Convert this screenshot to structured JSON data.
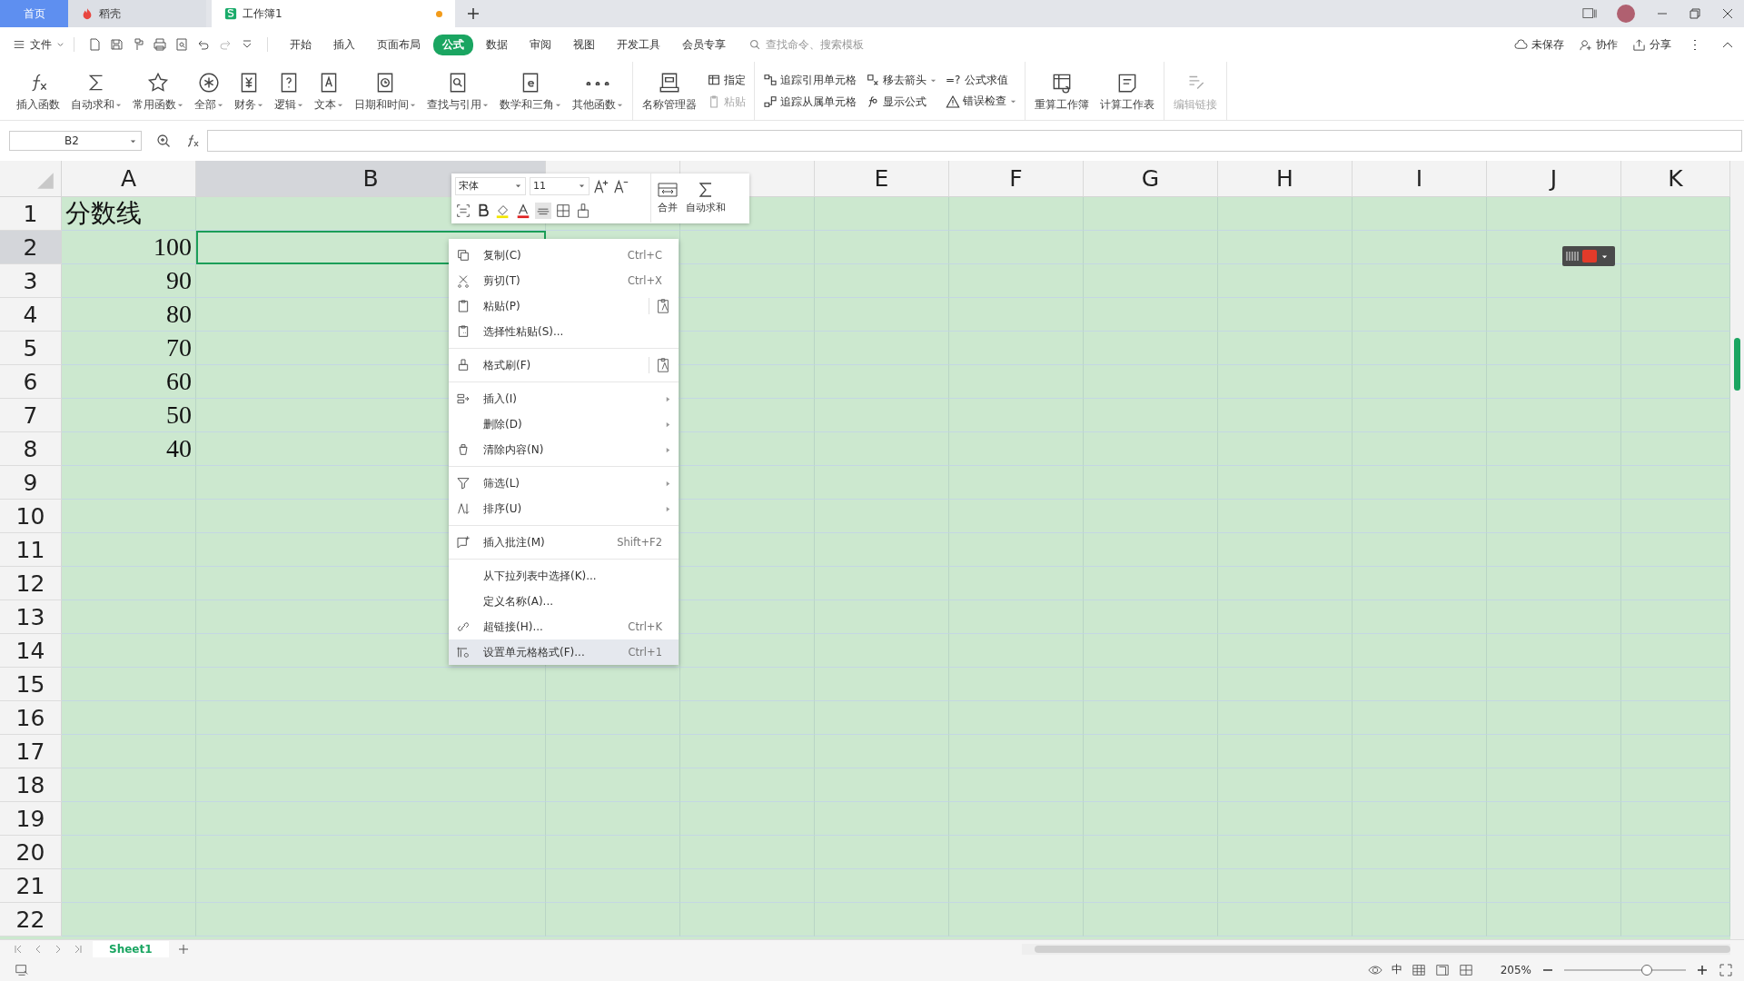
{
  "title_tabs": [
    {
      "label": "首页",
      "kind": "home",
      "selected": false,
      "unsaved": false
    },
    {
      "label": "稻壳",
      "kind": "docer",
      "selected": false,
      "unsaved": false
    },
    {
      "label": "工作簿1",
      "kind": "sheet",
      "selected": true,
      "unsaved": true
    }
  ],
  "menu": {
    "file": "文件",
    "tabs": [
      {
        "label": "开始",
        "selected": false
      },
      {
        "label": "插入",
        "selected": false
      },
      {
        "label": "页面布局",
        "selected": false
      },
      {
        "label": "公式",
        "selected": true
      },
      {
        "label": "数据",
        "selected": false
      },
      {
        "label": "审阅",
        "selected": false
      },
      {
        "label": "视图",
        "selected": false
      },
      {
        "label": "开发工具",
        "selected": false
      },
      {
        "label": "会员专享",
        "selected": false
      }
    ],
    "search": {
      "placeholder": "查找命令、搜索模板"
    },
    "actions": [
      "未保存",
      "协作",
      "分享"
    ]
  },
  "ribbon": {
    "groups": [
      {
        "columns": [
          [
            {
              "label": "插入函数",
              "kind": "large",
              "dropdown": false,
              "disabled": false
            }
          ],
          [
            {
              "label": "自动求和",
              "kind": "large",
              "dropdown": true,
              "disabled": false
            }
          ],
          [
            {
              "label": "常用函数",
              "kind": "large",
              "dropdown": true,
              "disabled": false
            }
          ],
          [
            {
              "label": "全部",
              "kind": "large",
              "dropdown": true,
              "disabled": false
            }
          ],
          [
            {
              "label": "财务",
              "kind": "large",
              "dropdown": true,
              "disabled": false
            }
          ],
          [
            {
              "label": "逻辑",
              "kind": "large",
              "dropdown": true,
              "disabled": false
            }
          ],
          [
            {
              "label": "文本",
              "kind": "large",
              "dropdown": true,
              "disabled": false
            }
          ],
          [
            {
              "label": "日期和时间",
              "kind": "large",
              "dropdown": true,
              "disabled": false
            }
          ],
          [
            {
              "label": "查找与引用",
              "kind": "large",
              "dropdown": true,
              "disabled": false
            }
          ],
          [
            {
              "label": "数学和三角",
              "kind": "large",
              "dropdown": true,
              "disabled": false
            }
          ],
          [
            {
              "label": "其他函数",
              "kind": "large",
              "dropdown": true,
              "disabled": false
            }
          ]
        ]
      },
      {
        "columns": [
          [
            {
              "label": "名称管理器",
              "kind": "large",
              "dropdown": false,
              "disabled": false
            }
          ],
          [
            {
              "label": "指定",
              "kind": "small",
              "dropdown": false,
              "disabled": false
            },
            {
              "label": "粘贴",
              "kind": "small",
              "dropdown": false,
              "disabled": true
            }
          ]
        ]
      },
      {
        "columns": [
          [
            {
              "label": "追踪引用单元格",
              "kind": "small",
              "dropdown": false,
              "disabled": false
            },
            {
              "label": "追踪从属单元格",
              "kind": "small",
              "dropdown": false,
              "disabled": false
            }
          ],
          [
            {
              "label": "移去箭头",
              "kind": "small",
              "dropdown": true,
              "disabled": false
            },
            {
              "label": "显示公式",
              "kind": "small",
              "dropdown": false,
              "disabled": false
            }
          ],
          [
            {
              "label": "公式求值",
              "kind": "small",
              "icon_text": "=?",
              "dropdown": false,
              "disabled": false
            },
            {
              "label": "错误检查",
              "kind": "small",
              "dropdown": true,
              "disabled": false
            }
          ]
        ]
      },
      {
        "columns": [
          [
            {
              "label": "重算工作簿",
              "kind": "large",
              "dropdown": false,
              "disabled": false
            }
          ],
          [
            {
              "label": "计算工作表",
              "kind": "large",
              "dropdown": false,
              "disabled": false
            }
          ]
        ]
      },
      {
        "columns": [
          [
            {
              "label": "编辑链接",
              "kind": "large",
              "dropdown": false,
              "disabled": true
            }
          ]
        ]
      }
    ]
  },
  "formula_bar": {
    "name_box": "B2"
  },
  "sheet": {
    "columns": [
      {
        "label": "A",
        "selected": false
      },
      {
        "label": "B",
        "selected": true
      },
      {
        "selected": false
      },
      {
        "selected": false
      },
      {
        "label": "E",
        "selected": false
      },
      {
        "label": "F",
        "selected": false
      },
      {
        "label": "G",
        "selected": false
      },
      {
        "label": "H",
        "selected": false
      },
      {
        "label": "I",
        "selected": false
      },
      {
        "label": "J",
        "selected": false
      },
      {
        "label": "K",
        "selected": false
      }
    ],
    "rows": [
      {
        "label": "1",
        "selected": false,
        "a": {
          "text": "分数线",
          "kind": "text"
        }
      },
      {
        "label": "2",
        "selected": true,
        "a": {
          "text": "100",
          "kind": "number"
        }
      },
      {
        "label": "3",
        "selected": false,
        "a": {
          "text": "90",
          "kind": "number"
        }
      },
      {
        "label": "4",
        "selected": false,
        "a": {
          "text": "80",
          "kind": "number"
        }
      },
      {
        "label": "5",
        "selected": false,
        "a": {
          "text": "70",
          "kind": "number"
        }
      },
      {
        "label": "6",
        "selected": false,
        "a": {
          "text": "60",
          "kind": "number"
        }
      },
      {
        "label": "7",
        "selected": false,
        "a": {
          "text": "50",
          "kind": "number"
        }
      },
      {
        "label": "8",
        "selected": false,
        "a": {
          "text": "40",
          "kind": "number"
        }
      },
      {
        "label": "9",
        "selected": false
      },
      {
        "label": "10",
        "selected": false
      },
      {
        "label": "11",
        "selected": false
      },
      {
        "label": "12",
        "selected": false
      },
      {
        "label": "13",
        "selected": false
      },
      {
        "label": "14",
        "selected": false
      },
      {
        "label": "15",
        "selected": false
      },
      {
        "label": "16",
        "selected": false
      },
      {
        "label": "17",
        "selected": false
      },
      {
        "label": "18",
        "selected": false
      },
      {
        "label": "19",
        "selected": false
      },
      {
        "label": "20",
        "selected": false
      },
      {
        "label": "21",
        "selected": false
      },
      {
        "label": "22",
        "selected": false
      }
    ]
  },
  "mini_toolbar": {
    "font": "宋体",
    "size": "11",
    "merge": "合并",
    "autosum": "自动求和"
  },
  "context_menu": {
    "groups": [
      [
        {
          "label": "复制(C)",
          "shortcut": "Ctrl+C",
          "submenu": false,
          "side_button": false,
          "highlighted": false
        },
        {
          "label": "剪切(T)",
          "shortcut": "Ctrl+X",
          "submenu": false,
          "side_button": false,
          "highlighted": false
        },
        {
          "label": "粘贴(P)",
          "submenu": false,
          "side_button": true,
          "highlighted": false
        },
        {
          "label": "选择性粘贴(S)...",
          "submenu": false,
          "side_button": false,
          "highlighted": false
        }
      ],
      [
        {
          "label": "格式刷(F)",
          "submenu": false,
          "side_button": true,
          "highlighted": false
        }
      ],
      [
        {
          "label": "插入(I)",
          "submenu": true,
          "side_button": false,
          "highlighted": false
        },
        {
          "label": "删除(D)",
          "submenu": true,
          "side_button": false,
          "highlighted": false
        },
        {
          "label": "清除内容(N)",
          "submenu": true,
          "side_button": false,
          "highlighted": false
        }
      ],
      [
        {
          "label": "筛选(L)",
          "submenu": true,
          "side_button": false,
          "highlighted": false
        },
        {
          "label": "排序(U)",
          "submenu": true,
          "side_button": false,
          "highlighted": false
        }
      ],
      [
        {
          "label": "插入批注(M)",
          "shortcut": "Shift+F2",
          "submenu": false,
          "side_button": false,
          "highlighted": false
        }
      ],
      [
        {
          "label": "从下拉列表中选择(K)...",
          "submenu": false,
          "side_button": false,
          "highlighted": false
        },
        {
          "label": "定义名称(A)...",
          "submenu": false,
          "side_button": false,
          "highlighted": false
        },
        {
          "label": "超链接(H)...",
          "shortcut": "Ctrl+K",
          "submenu": false,
          "side_button": false,
          "highlighted": false
        },
        {
          "label": "设置单元格格式(F)...",
          "shortcut": "Ctrl+1",
          "submenu": false,
          "side_button": false,
          "highlighted": true
        }
      ]
    ]
  },
  "sheet_tabs": [
    {
      "label": "Sheet1",
      "selected": true
    }
  ],
  "status_bar": {
    "ime": "中",
    "zoom": "205%",
    "zoom_slider": {
      "level": 0.68
    }
  }
}
